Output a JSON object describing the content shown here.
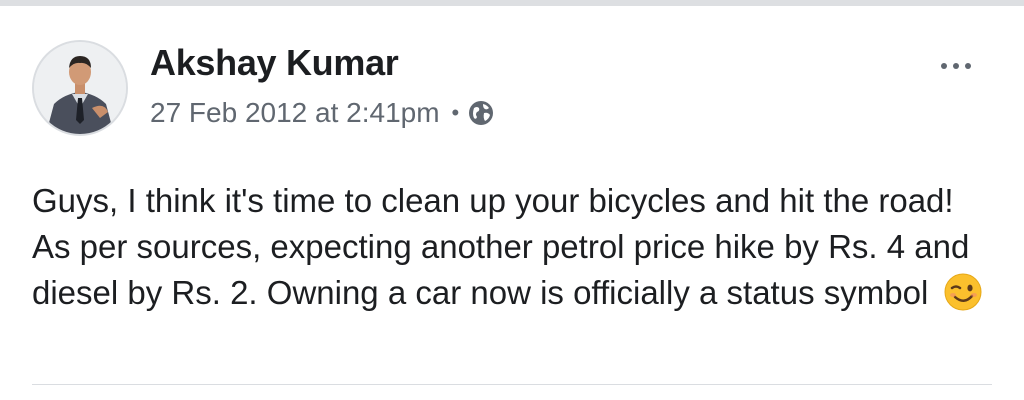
{
  "post": {
    "author": "Akshay Kumar",
    "timestamp": "27 Feb 2012 at 2:41pm",
    "separator": "•",
    "audience_icon": "globe-icon",
    "more_icon": "more-options-icon",
    "text": "Guys, I think it's time to clean up your bicycles  and hit the road! As per sources, expecting another petrol price hike by Rs. 4 and diesel by Rs. 2. Owning a car now is officially a status symbol",
    "emoji_icon": "winking-face-icon"
  },
  "colors": {
    "text_primary": "#1c1e21",
    "text_secondary": "#606770",
    "divider": "#dadde1",
    "emoji_yellow": "#fbc02d"
  }
}
